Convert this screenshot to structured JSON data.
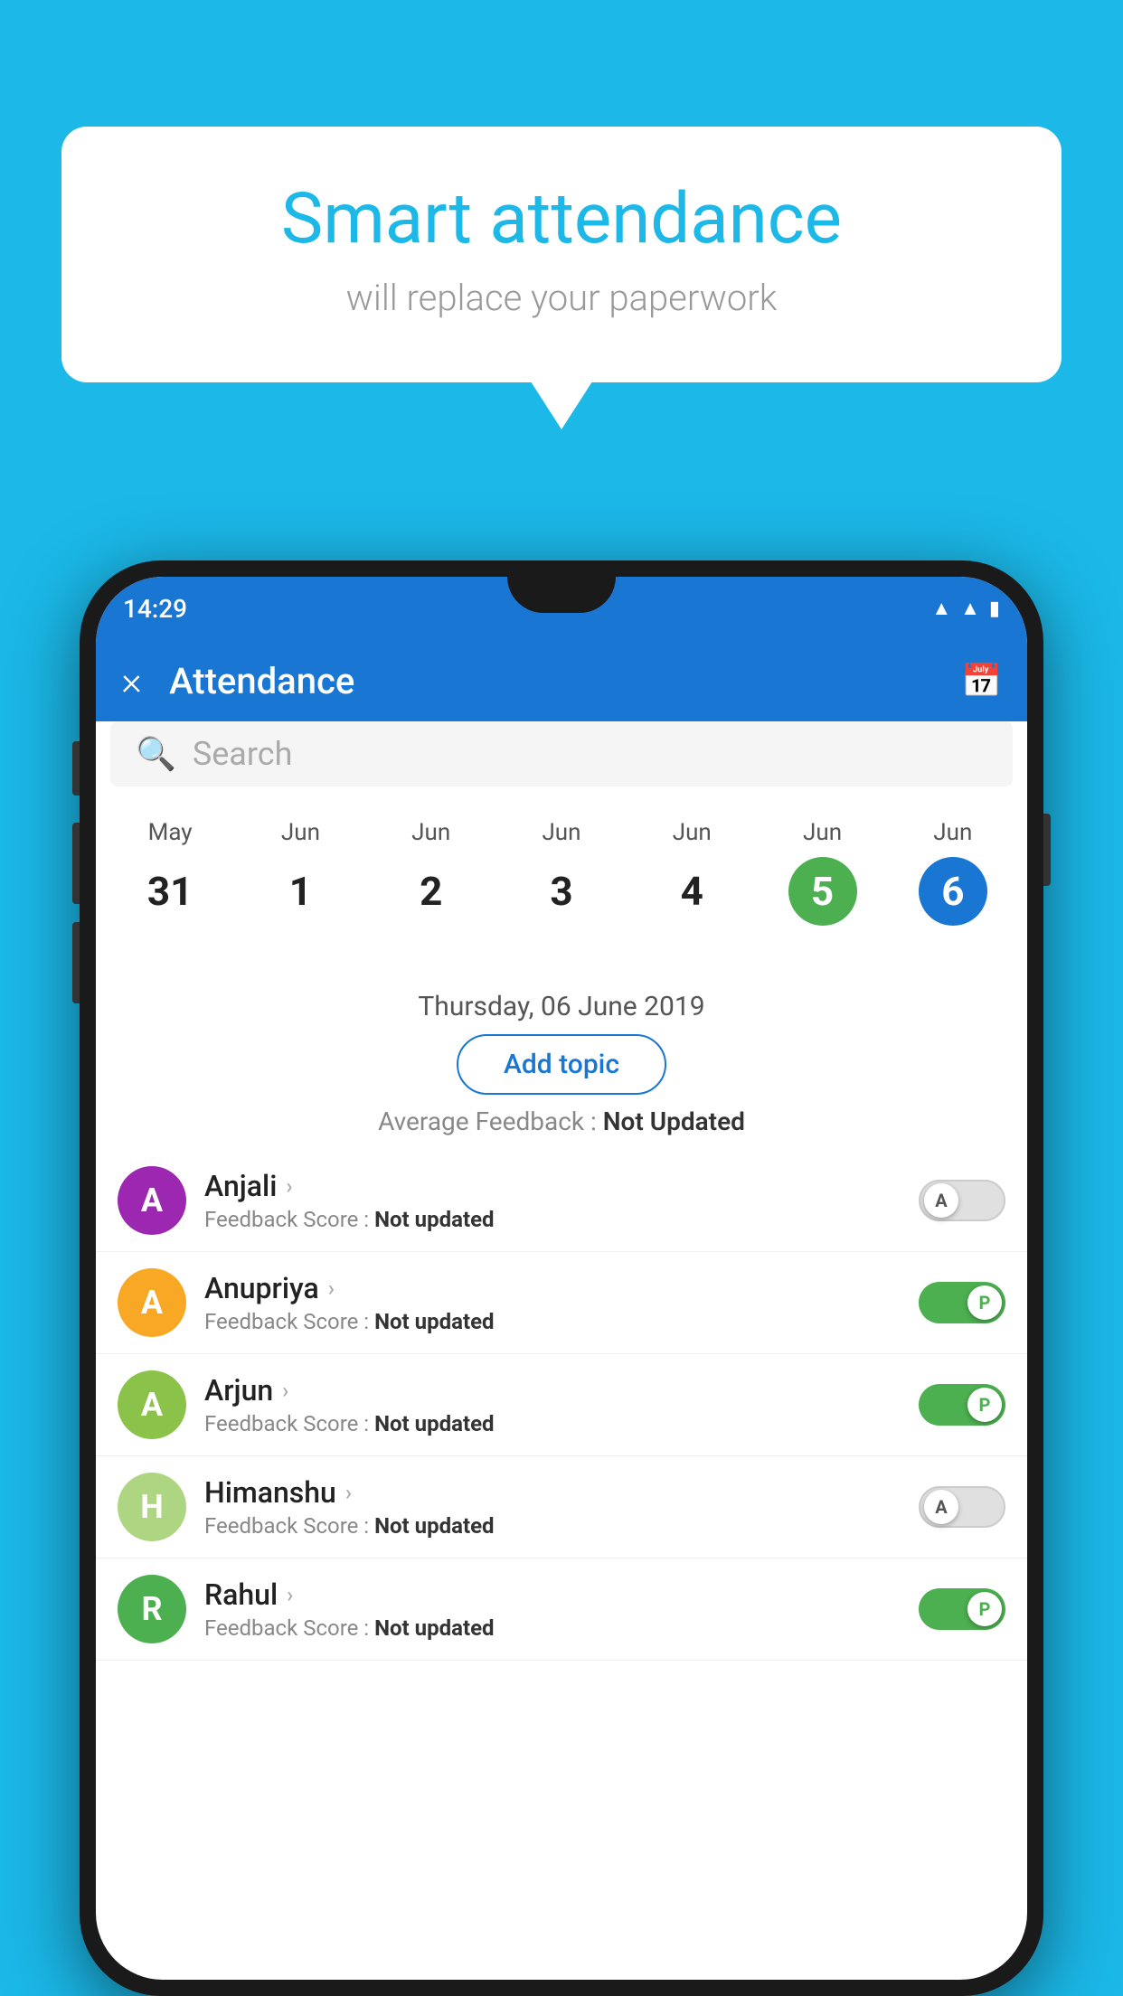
{
  "background_color": "#1bb8e8",
  "speech_bubble": {
    "title": "Smart attendance",
    "subtitle": "will replace your paperwork"
  },
  "status_bar": {
    "time": "14:29",
    "icons": [
      "wifi",
      "signal",
      "battery"
    ]
  },
  "app_bar": {
    "title": "Attendance",
    "close_label": "×",
    "calendar_icon": "📅"
  },
  "search": {
    "placeholder": "Search"
  },
  "calendar": {
    "days": [
      {
        "month": "May",
        "date": "31",
        "state": "normal"
      },
      {
        "month": "Jun",
        "date": "1",
        "state": "normal"
      },
      {
        "month": "Jun",
        "date": "2",
        "state": "normal"
      },
      {
        "month": "Jun",
        "date": "3",
        "state": "normal"
      },
      {
        "month": "Jun",
        "date": "4",
        "state": "normal"
      },
      {
        "month": "Jun",
        "date": "5",
        "state": "today"
      },
      {
        "month": "Jun",
        "date": "6",
        "state": "selected"
      }
    ]
  },
  "selected_date": "Thursday, 06 June 2019",
  "add_topic_label": "Add topic",
  "avg_feedback_label": "Average Feedback : ",
  "avg_feedback_value": "Not Updated",
  "students": [
    {
      "name": "Anjali",
      "initial": "A",
      "avatar_color": "#9c27b0",
      "feedback_label": "Feedback Score : ",
      "feedback_value": "Not updated",
      "toggle_state": "off",
      "toggle_label": "A"
    },
    {
      "name": "Anupriya",
      "initial": "A",
      "avatar_color": "#f9a825",
      "feedback_label": "Feedback Score : ",
      "feedback_value": "Not updated",
      "toggle_state": "on",
      "toggle_label": "P"
    },
    {
      "name": "Arjun",
      "initial": "A",
      "avatar_color": "#8bc34a",
      "feedback_label": "Feedback Score : ",
      "feedback_value": "Not updated",
      "toggle_state": "on",
      "toggle_label": "P"
    },
    {
      "name": "Himanshu",
      "initial": "H",
      "avatar_color": "#aed581",
      "feedback_label": "Feedback Score : ",
      "feedback_value": "Not updated",
      "toggle_state": "off",
      "toggle_label": "A"
    },
    {
      "name": "Rahul",
      "initial": "R",
      "avatar_color": "#4caf50",
      "feedback_label": "Feedback Score : ",
      "feedback_value": "Not updated",
      "toggle_state": "on",
      "toggle_label": "P"
    }
  ]
}
